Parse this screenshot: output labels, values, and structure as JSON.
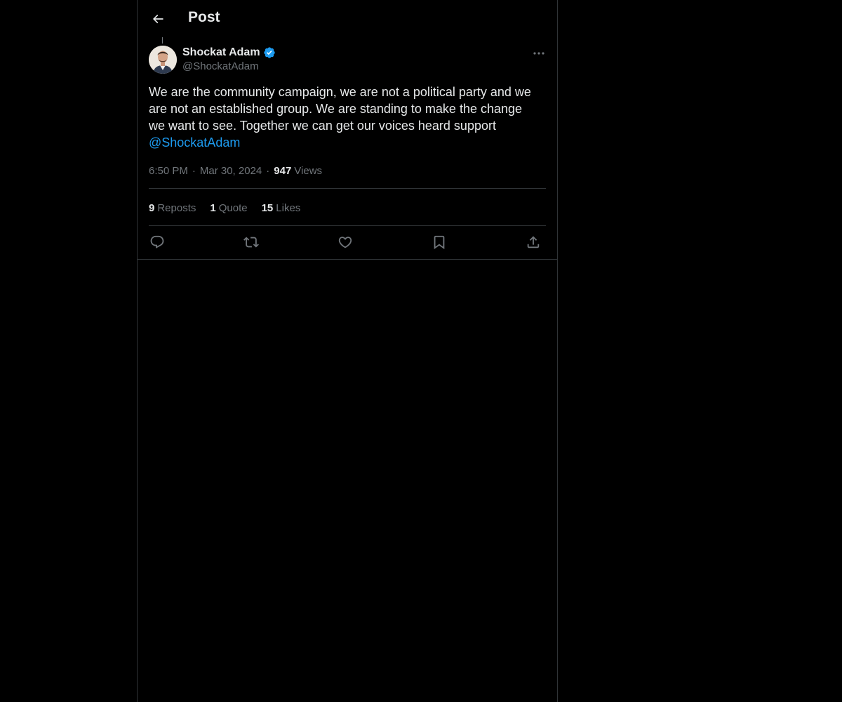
{
  "header": {
    "title": "Post"
  },
  "author": {
    "name": "Shockat Adam",
    "handle": "@ShockatAdam",
    "verified": true
  },
  "post": {
    "text": "We are the community campaign, we are not a political party and we are not an established group. We are standing to make the change we want to see. Together we can get our voices heard support ",
    "mention": "@ShockatAdam"
  },
  "meta": {
    "time": "6:50 PM",
    "date": "Mar 30, 2024",
    "views_count": "947",
    "views_label": "Views"
  },
  "stats": {
    "reposts_count": "9",
    "reposts_label": "Reposts",
    "quotes_count": "1",
    "quotes_label": "Quote",
    "likes_count": "15",
    "likes_label": "Likes"
  },
  "colors": {
    "background": "#000000",
    "text": "#e7e9ea",
    "secondary_text": "#71767b",
    "accent": "#1d9bf0",
    "border": "#2f3336"
  },
  "icons": {
    "back": "arrow-left-icon",
    "verified": "verified-badge-icon",
    "more": "more-horizontal-icon",
    "reply": "reply-icon",
    "repost": "repost-icon",
    "like": "heart-icon",
    "bookmark": "bookmark-icon",
    "share": "share-icon"
  }
}
